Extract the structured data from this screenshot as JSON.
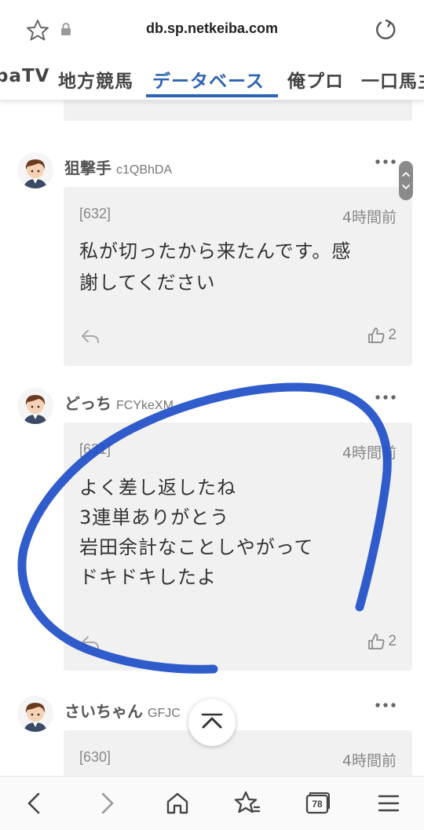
{
  "browser": {
    "url": "db.sp.netkeiba.com",
    "icons": [
      "bookmark-star-icon",
      "lock-icon",
      "reload-icon"
    ]
  },
  "tabs": [
    {
      "label": "baTV"
    },
    {
      "label": "地方競馬"
    },
    {
      "label": "データベース",
      "active": true
    },
    {
      "label": "俺プロ"
    },
    {
      "label": "一口馬主"
    }
  ],
  "comments": [
    {
      "user": "狙撃手",
      "uid": "c1QBhDA",
      "number": "[632]",
      "time": "4時間前",
      "lines": [
        "私が切ったから来たんです。感",
        "謝してください"
      ],
      "likes": "2"
    },
    {
      "user": "どっち",
      "uid": "FCYkeXM",
      "number": "[631]",
      "time": "4時間前",
      "lines": [
        "よく差し返したね",
        "3連単ありがとう",
        "岩田余計なことしやがって",
        "ドキドキしたよ"
      ],
      "likes": "2"
    },
    {
      "user": "さいちゃん",
      "uid": "GFJC",
      "number": "[630]",
      "time": "4時間前",
      "lines": [],
      "likes": ""
    }
  ],
  "bottom_nav": {
    "tab_count": "78",
    "icons": [
      "back-icon",
      "forward-icon",
      "home-icon",
      "bookmarks-icon",
      "tabs-icon",
      "menu-icon"
    ]
  },
  "colors": {
    "accent": "#2f63b3",
    "annotation": "#1f4fc8",
    "card_bg": "#f1f1f1"
  }
}
